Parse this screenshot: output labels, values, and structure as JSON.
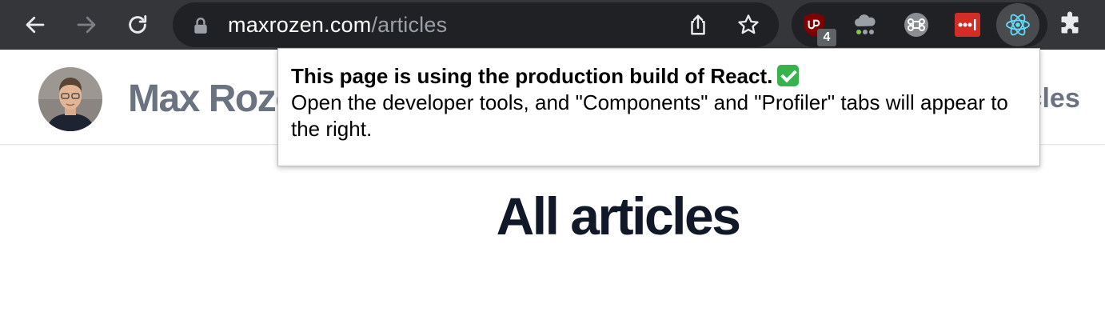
{
  "browser": {
    "url_host": "maxrozen.com",
    "url_path": "/articles",
    "ublock_badge": "4",
    "icons": [
      "back-arrow-icon",
      "forward-arrow-icon",
      "reload-icon",
      "lock-icon",
      "share-icon",
      "star-icon",
      "ublock-icon",
      "cloud-icon",
      "command-icon",
      "lastpass-icon",
      "react-icon",
      "puzzle-icon"
    ]
  },
  "site": {
    "title": "Max Rozen",
    "nav_link": "Articles"
  },
  "page": {
    "heading": "All articles"
  },
  "popup": {
    "title": "This page is using the production build of React.",
    "body": "Open the developer tools, and \"Components\" and \"Profiler\" tabs will appear to the right."
  },
  "colors": {
    "toolbar": "#35363a",
    "omnibox": "#202124",
    "heading": "#111827",
    "site_text": "#6b7280",
    "react": "#61dafb",
    "ublock": "#800000",
    "lastpass": "#d32d27",
    "check": "#37b24d"
  }
}
